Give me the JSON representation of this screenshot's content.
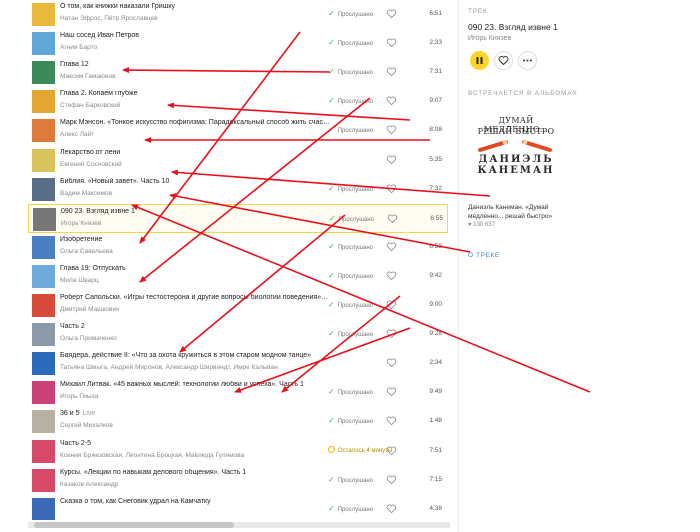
{
  "tracks": [
    {
      "title": "О том, как книжки наказали Гришку",
      "artist": "Натан Эфрос, Пётр Ярославцев",
      "status": "Прослушано",
      "status_kind": "done",
      "duration": "6:51",
      "cover_color": "#e8b93a"
    },
    {
      "title": "Наш сосед Иван Петров",
      "artist": "Агния Барто",
      "status": "Прослушано",
      "status_kind": "done",
      "duration": "2:33",
      "cover_color": "#5fa7d9"
    },
    {
      "title": "Глава 12",
      "artist": "Максим Гамаюнов",
      "status": "Прослушано",
      "status_kind": "done",
      "duration": "7:31",
      "cover_color": "#3a8a5a"
    },
    {
      "title": "Глава 2. Копаем глубже",
      "artist": "Стефан Барковский",
      "status": "Прослушано",
      "status_kind": "done",
      "duration": "9:07",
      "cover_color": "#e4a533"
    },
    {
      "title": "Марк Мэнсон. «Тонкое искусство пофигизма: Парадоксальный способ жить счастли...",
      "artist": "Алекс Лайт",
      "status": "Прослушано",
      "status_kind": "done",
      "duration": "8:08",
      "cover_color": "#e07a3a"
    },
    {
      "title": "Лекарство от лени",
      "artist": "Евгений Сосновский",
      "status": "",
      "status_kind": "none",
      "duration": "5:35",
      "cover_color": "#d9c35a"
    },
    {
      "title": "Библия. «Новый завет». Часть 10",
      "artist": "Вадим Максимов",
      "status": "Прослушано",
      "status_kind": "done",
      "duration": "7:32",
      "cover_color": "#5a6e8a"
    },
    {
      "title": "090 23. Взгляд извне 1",
      "artist": "Игорь Князев",
      "status": "Прослушано",
      "status_kind": "done",
      "duration": "6:55",
      "cover_color": "#777777",
      "active": true
    },
    {
      "title": "Изобретение",
      "artist": "Ольга Савельева",
      "status": "Прослушано",
      "status_kind": "done",
      "duration": "6:53",
      "cover_color": "#4a7fc1"
    },
    {
      "title": "Глава 19: Отпускать",
      "artist": "Мила Шварц",
      "status": "Прослушано",
      "status_kind": "done",
      "duration": "9:42",
      "cover_color": "#6ea9d8"
    },
    {
      "title": "Роберт Сапольски. «Игры тестостерона и другие вопросы биологии поведения». Ч...",
      "artist": "Дмитрий Машкович",
      "status": "Прослушано",
      "status_kind": "done",
      "duration": "9:00",
      "cover_color": "#d94a3a"
    },
    {
      "title": "Часть 2",
      "artist": "Ольга Примаченко",
      "status": "Прослушано",
      "status_kind": "done",
      "duration": "9:28",
      "cover_color": "#8a9aa8"
    },
    {
      "title": "Баядера, действие II: «Что за охота кружиться в этом старом модном танце»",
      "artist": "Татьяна Шмыга, Андрей Миронов, Александр Ширвиндт, Имре Кальман",
      "status": "",
      "status_kind": "none",
      "duration": "2:34",
      "cover_color": "#2a6ab8"
    },
    {
      "title": "Михаил Литвак. «45 важных мыслей: технологии любви и успеха». Часть 1",
      "artist": "Игорь Гмыза",
      "status": "Прослушано",
      "status_kind": "done",
      "duration": "9:49",
      "cover_color": "#c9427a"
    },
    {
      "title": "36 и 5",
      "title_badge": "Live",
      "artist": "Сергей Михалков",
      "status": "Прослушано",
      "status_kind": "done",
      "duration": "1:48",
      "cover_color": "#b8b0a0"
    },
    {
      "title": "Часть 2-5",
      "artist": "Ксения Бржезовская, Леонтина Броцкая, Мавлюда Гулямова",
      "status": "Осталось 4 минуты",
      "status_kind": "remaining",
      "duration": "7:51",
      "cover_color": "#d94a6a"
    },
    {
      "title": "Курсы. «Лекции по навыкам делового общения». Часть 1",
      "artist": "Казаков Александр",
      "status": "Прослушано",
      "status_kind": "done",
      "duration": "7:15",
      "cover_color": "#d94a6a"
    },
    {
      "title": "Сказка о том, как Снеговик удрал на Камчатку",
      "artist": "",
      "status": "Прослушано",
      "status_kind": "done",
      "duration": "4:38",
      "cover_color": "#3a6ab8"
    }
  ],
  "panel": {
    "label_track": "ТРЕК",
    "title": "090 23. Взгляд извне 1",
    "artist": "Игорь Князев",
    "label_albums": "ВСТРЕЧАЕТСЯ В АЛЬБОМАХ",
    "book_line1": "ДУМАЙ МЕДЛЕННО…",
    "book_line2": "РЕШАЙ БЫСТРО",
    "book_author": "ДАНИЭЛЬ КАНЕМАН",
    "album_title": "Даниэль Канеман. «Думай медленно... решай быстро»",
    "album_likes": "130 637",
    "about_link": "О ТРЕКЕ"
  },
  "colors": {
    "accent": "#fed42b",
    "done": "#3bb34a",
    "link": "#3d86c6",
    "annotation": "#e8101a"
  }
}
